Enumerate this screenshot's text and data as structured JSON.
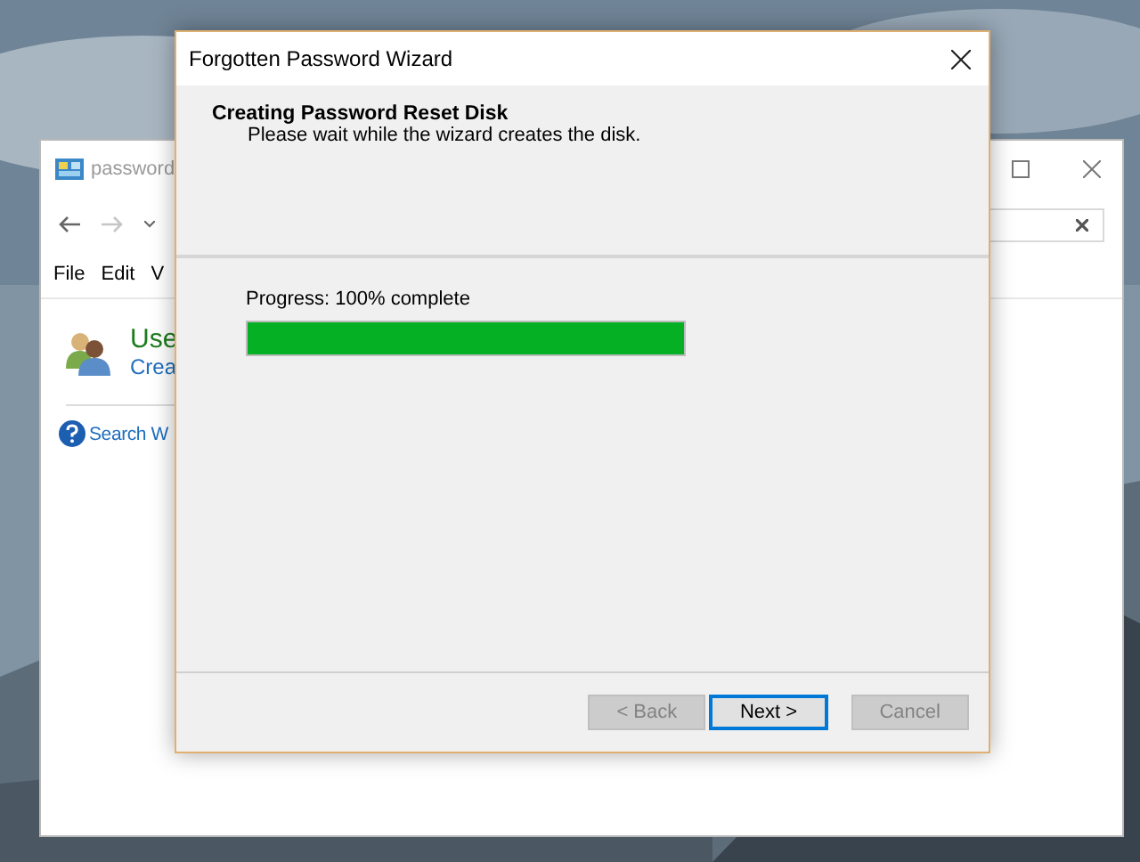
{
  "background_window": {
    "title": "password",
    "menu": [
      "File",
      "Edit",
      "V"
    ],
    "heading": "Use",
    "link": "Crea",
    "help_link": "Search W"
  },
  "dialog": {
    "title": "Forgotten Password Wizard",
    "heading": "Creating Password Reset Disk",
    "subheading": "Please wait while the wizard creates the disk.",
    "progress": {
      "label": "Progress: 100% complete",
      "level": 1
    },
    "buttons": [
      {
        "label": "< Back",
        "disabled": true,
        "default": false
      },
      {
        "label": "Next >",
        "disabled": false,
        "default": true
      },
      {
        "label": "Cancel",
        "disabled": true,
        "default": false
      }
    ]
  }
}
